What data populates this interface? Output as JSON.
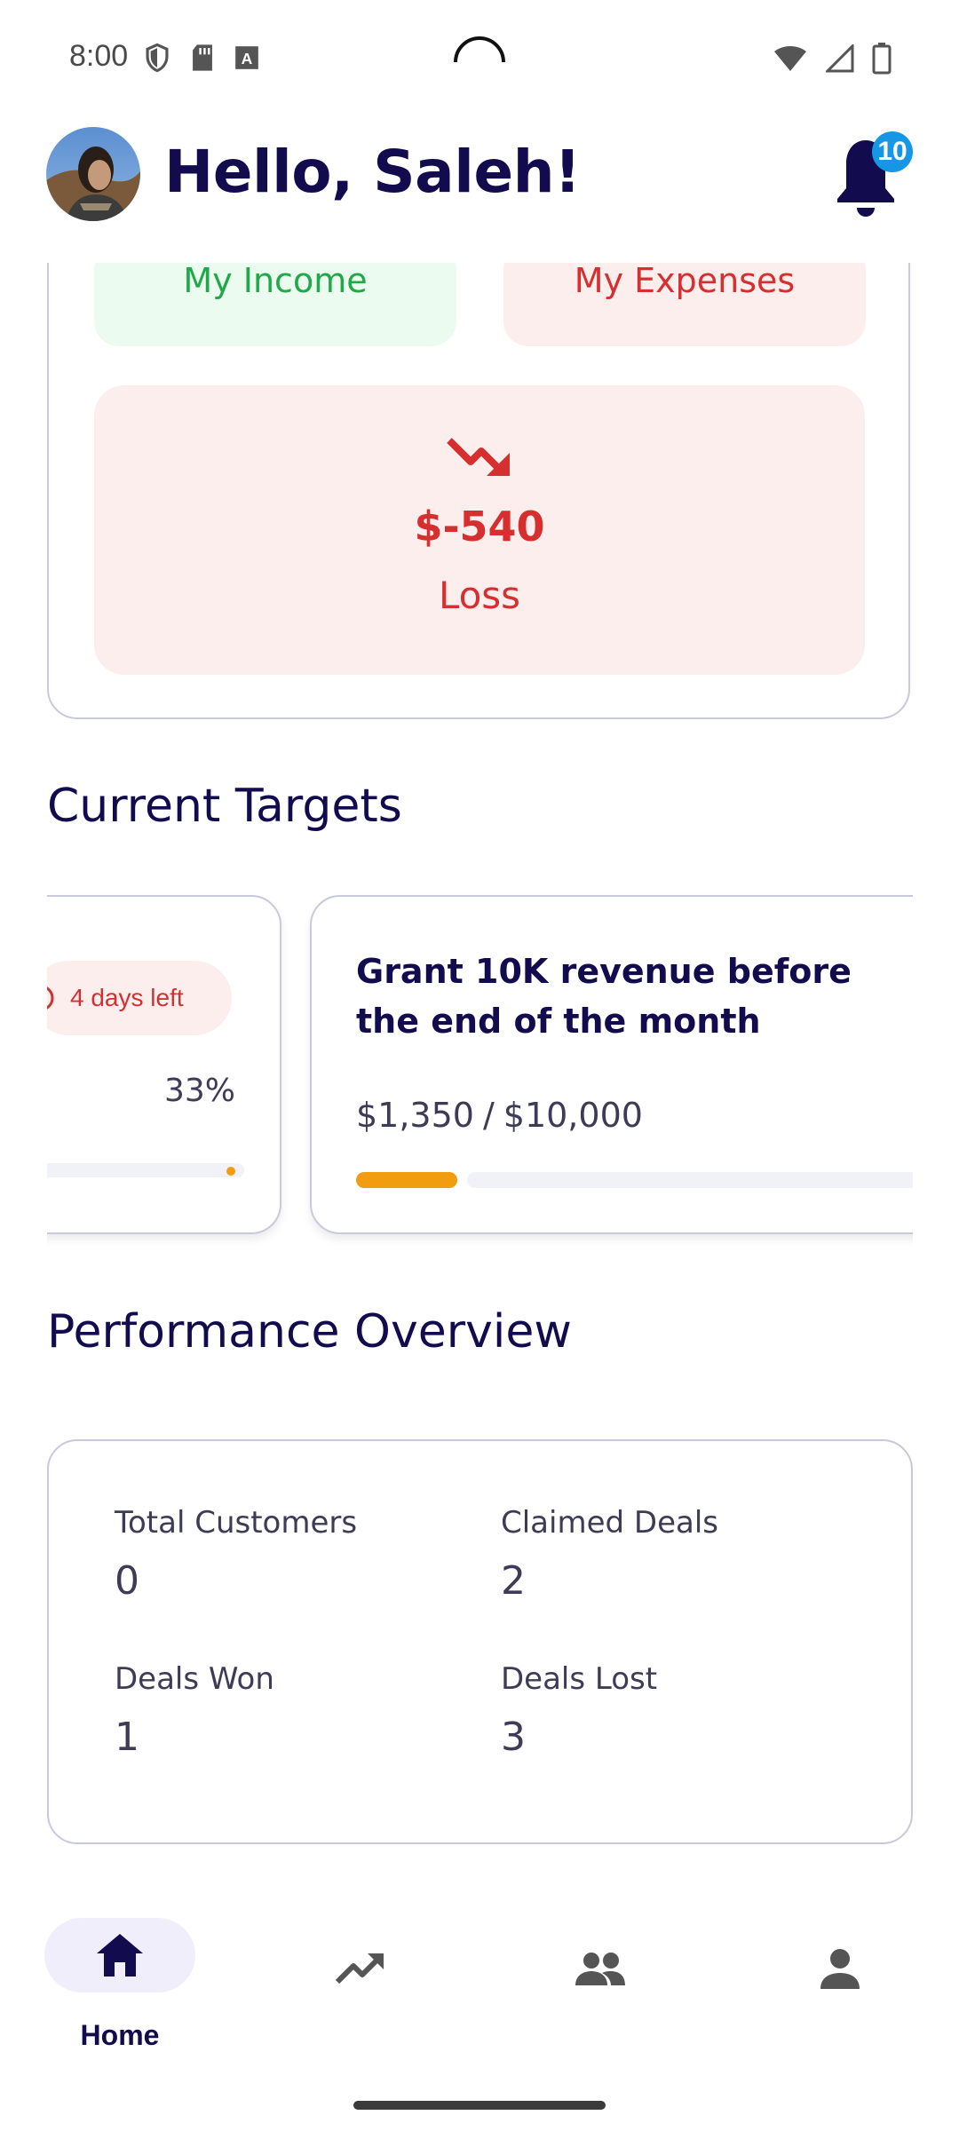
{
  "status_bar": {
    "time": "8:00",
    "left_icons": [
      "shield-icon",
      "sd-card-icon",
      "keyboard-icon"
    ],
    "right_icons": [
      "wifi-icon",
      "signal-icon",
      "battery-icon"
    ]
  },
  "header": {
    "greeting": "Hello, Saleh!",
    "notification_count": "10"
  },
  "summary": {
    "income_label": "My Income",
    "expenses_label": "My Expenses",
    "net_amount": "$-540",
    "net_label": "Loss",
    "net_icon": "trending-down-icon"
  },
  "targets": {
    "title": "Current Targets",
    "items": [
      {
        "days_left": "4 days left",
        "percent": "33%"
      },
      {
        "title": "Grant 10K revenue before the end of the month",
        "current": "$1,350",
        "separator": "/",
        "goal": "$10,000",
        "progress": 0.135
      }
    ]
  },
  "performance": {
    "title": "Performance Overview",
    "stats": [
      {
        "label": "Total Customers",
        "value": "0"
      },
      {
        "label": "Claimed Deals",
        "value": "2"
      },
      {
        "label": "Deals Won",
        "value": "1"
      },
      {
        "label": "Deals Lost",
        "value": "3"
      }
    ]
  },
  "bottom_nav": {
    "items": [
      {
        "label": "Home",
        "icon": "home-icon",
        "active": true
      },
      {
        "label": "",
        "icon": "trending-up-icon",
        "active": false
      },
      {
        "label": "",
        "icon": "people-icon",
        "active": false
      },
      {
        "label": "",
        "icon": "person-icon",
        "active": false
      }
    ]
  },
  "colors": {
    "primary": "#120c4f",
    "income": "#21a84a",
    "loss": "#d62f2f",
    "progress": "#f29d10",
    "badge": "#1597e5"
  }
}
